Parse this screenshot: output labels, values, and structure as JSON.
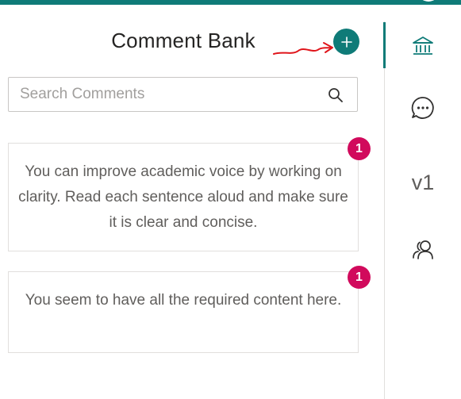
{
  "header": {
    "title": "Comment Bank",
    "add_button_icon": "plus-icon"
  },
  "search": {
    "placeholder": "Search Comments",
    "value": "",
    "icon": "search-icon"
  },
  "comments": [
    {
      "text": "You can improve academic voice by working on clarity. Read each sentence aloud and make sure it is clear and concise.",
      "badge_count": "1"
    },
    {
      "text": "You seem to have all the required content here.",
      "badge_count": "1"
    }
  ],
  "sidebar": {
    "items": [
      {
        "icon": "bank-icon",
        "active": true
      },
      {
        "icon": "chat-bubble-icon",
        "active": false
      },
      {
        "label": "v1",
        "active": false
      },
      {
        "icon": "people-icon",
        "active": false
      }
    ]
  },
  "colors": {
    "accent": "#0f7b78",
    "badge": "#d10a5c",
    "annotation_arrow": "#e0151b"
  }
}
